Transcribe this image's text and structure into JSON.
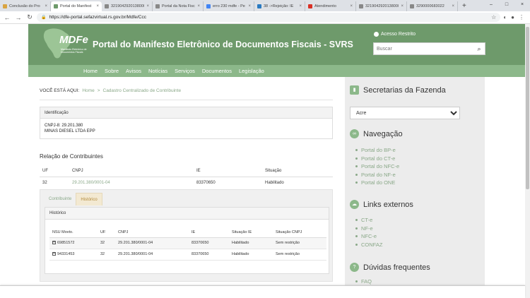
{
  "browser": {
    "tabs": [
      {
        "label": "Conclusão do Pro",
        "color": "#d9a441"
      },
      {
        "label": "Portal do Manifest",
        "color": "#6e9a6b",
        "active": true
      },
      {
        "label": "3219042920138000",
        "color": "#888888"
      },
      {
        "label": "Portal da Nota Fisc",
        "color": "#888888"
      },
      {
        "label": "erro 230 mdfe - Pe",
        "color": "#4285f4"
      },
      {
        "label": "38 ->Rejeição: IE",
        "color": "#2a7ac1"
      },
      {
        "label": "Atendimento",
        "color": "#d93025"
      },
      {
        "label": "3219042920138000",
        "color": "#888888"
      },
      {
        "label": "3290000683022",
        "color": "#888888"
      }
    ],
    "new_tab": "+",
    "url": "https://dfe-portal.sefazvirtual.rs.gov.br/Mdfe/Ccc"
  },
  "header": {
    "logo_text": "MDFe",
    "logo_subtext": "Manifesto Eletrônico de Documentos Fiscais",
    "title": "Portal do Manifesto Eletrônico de Documentos Fiscais - SVRS",
    "acesso": "Acesso Restrito",
    "search_placeholder": "Buscar"
  },
  "nav": [
    "Home",
    "Sobre",
    "Avisos",
    "Notícias",
    "Serviços",
    "Documentos",
    "Legislação"
  ],
  "breadcrumb": {
    "label": "VOCÊ ESTÁ AQUI:",
    "home": "Home",
    "sep": ">",
    "current": "Cadastro Centralizado de Contribuinte"
  },
  "identificacao": {
    "title": "Identificação",
    "cnpj": "CNPJ-8: 29.201.380",
    "name": "MINAS DIESEL LTDA EPP"
  },
  "relacao": {
    "title": "Relação de Contribuintes",
    "headers": [
      "UF",
      "CNPJ",
      "IE",
      "Situação"
    ],
    "row": {
      "uf": "32",
      "cnpj": "29.201.380/0001-04",
      "ie": "83370650",
      "situacao": "Habilitado"
    }
  },
  "detail": {
    "tabs": [
      "Contribuinte",
      "Histórico"
    ],
    "historico_title": "Histórico",
    "headers": [
      "NSU Movto.",
      "UF",
      "CNPJ",
      "IE",
      "Situação IE",
      "Situação CNPJ"
    ],
    "rows": [
      {
        "nsu": "69851572",
        "uf": "32",
        "cnpj": "29.201.380/0001-04",
        "ie": "83370650",
        "sit_ie": "Habilitado",
        "sit_cnpj": "Sem restrição"
      },
      {
        "nsu": "94331453",
        "uf": "32",
        "cnpj": "29.201.380/0001-04",
        "ie": "83370650",
        "sit_ie": "Habilitado",
        "sit_cnpj": "Sem restrição"
      }
    ]
  },
  "sidebar": {
    "secretarias": {
      "title": "Secretarias da Fazenda",
      "selected": "Acre"
    },
    "navegacao": {
      "title": "Navegação",
      "items": [
        "Portal do BP-e",
        "Portal do CT-e",
        "Portal do NFC-e",
        "Portal do NF-e",
        "Portal do ONE"
      ]
    },
    "links": {
      "title": "Links externos",
      "items": [
        "CT-e",
        "NF-e",
        "NFC-e",
        "CONFAZ"
      ]
    },
    "duvidas": {
      "title": "Dúvidas frequentes",
      "items": [
        "FAQ"
      ]
    }
  }
}
